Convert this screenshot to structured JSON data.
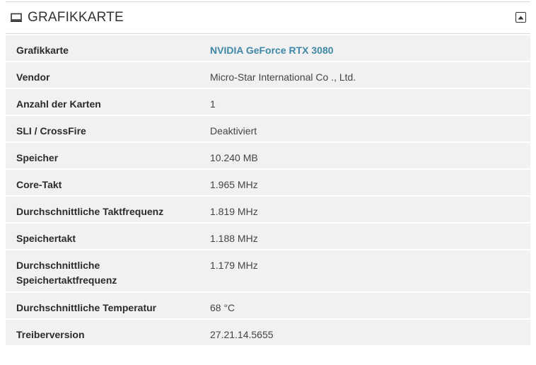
{
  "panel": {
    "title": "GRAFIKKARTE",
    "icon": "monitor-icon",
    "collapse_icon": "collapse-up-icon"
  },
  "rows": [
    {
      "label": "Grafikkarte",
      "value": "NVIDIA GeForce RTX 3080",
      "link": true
    },
    {
      "label": "Vendor",
      "value": "Micro-Star International Co ., Ltd."
    },
    {
      "label": "Anzahl der Karten",
      "value": "1"
    },
    {
      "label": "SLI / CrossFire",
      "value": "Deaktiviert"
    },
    {
      "label": "Speicher",
      "value": "10.240 MB"
    },
    {
      "label": "Core-Takt",
      "value": "1.965 MHz"
    },
    {
      "label": "Durchschnittliche Taktfrequenz",
      "value": "1.819 MHz"
    },
    {
      "label": "Speichertakt",
      "value": "1.188 MHz"
    },
    {
      "label": "Durchschnittliche Speichertaktfrequenz",
      "value": "1.179 MHz"
    },
    {
      "label": "Durchschnittliche Temperatur",
      "value": "68 °C"
    },
    {
      "label": "Treiberversion",
      "value": "27.21.14.5655"
    }
  ],
  "colors": {
    "link": "#3f87a6",
    "row_bg": "#f1f1f1"
  }
}
